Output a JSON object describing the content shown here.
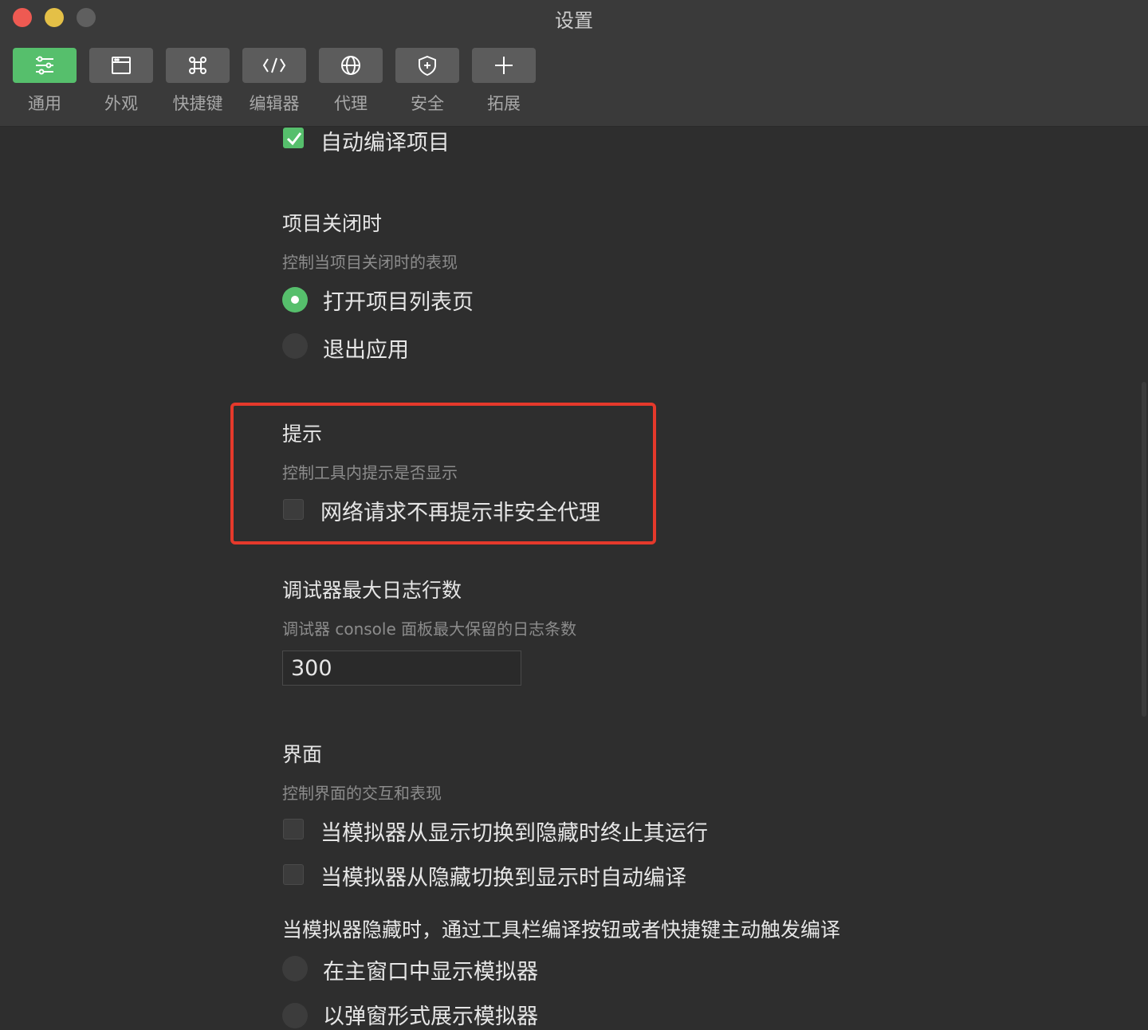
{
  "window": {
    "title": "设置"
  },
  "toolbar": {
    "tabs": [
      {
        "label": "通用",
        "icon": "sliders-icon",
        "active": true
      },
      {
        "label": "外观",
        "icon": "window-icon"
      },
      {
        "label": "快捷键",
        "icon": "command-key-icon"
      },
      {
        "label": "编辑器",
        "icon": "code-icon"
      },
      {
        "label": "代理",
        "icon": "globe-icon"
      },
      {
        "label": "安全",
        "icon": "shield-icon"
      },
      {
        "label": "拓展",
        "icon": "plus-icon"
      }
    ]
  },
  "colors": {
    "accent": "#56bf6c",
    "highlight": "#e5392b",
    "background": "#2e2e2e"
  },
  "settings": {
    "auto_compile": {
      "label": "自动编译项目",
      "checked": true
    },
    "project_close": {
      "title": "项目关闭时",
      "desc": "控制当项目关闭时的表现",
      "options": [
        {
          "label": "打开项目列表页",
          "selected": true
        },
        {
          "label": "退出应用",
          "selected": false
        }
      ]
    },
    "tips": {
      "title": "提示",
      "desc": "控制工具内提示是否显示",
      "option": {
        "label": "网络请求不再提示非安全代理",
        "checked": false
      }
    },
    "debugger": {
      "title": "调试器最大日志行数",
      "desc": "调试器 console 面板最大保留的日志条数",
      "value": "300"
    },
    "ui": {
      "title": "界面",
      "desc": "控制界面的交互和表现",
      "options": [
        {
          "label": "当模拟器从显示切换到隐藏时终止其运行",
          "checked": false
        },
        {
          "label": "当模拟器从隐藏切换到显示时自动编译",
          "checked": false
        }
      ],
      "hidden_note": "当模拟器隐藏时，通过工具栏编译按钮或者快捷键主动触发编译",
      "radio_options": [
        {
          "label": "在主窗口中显示模拟器",
          "selected": false
        },
        {
          "label": "以弹窗形式展示模拟器",
          "selected": false
        }
      ]
    }
  }
}
